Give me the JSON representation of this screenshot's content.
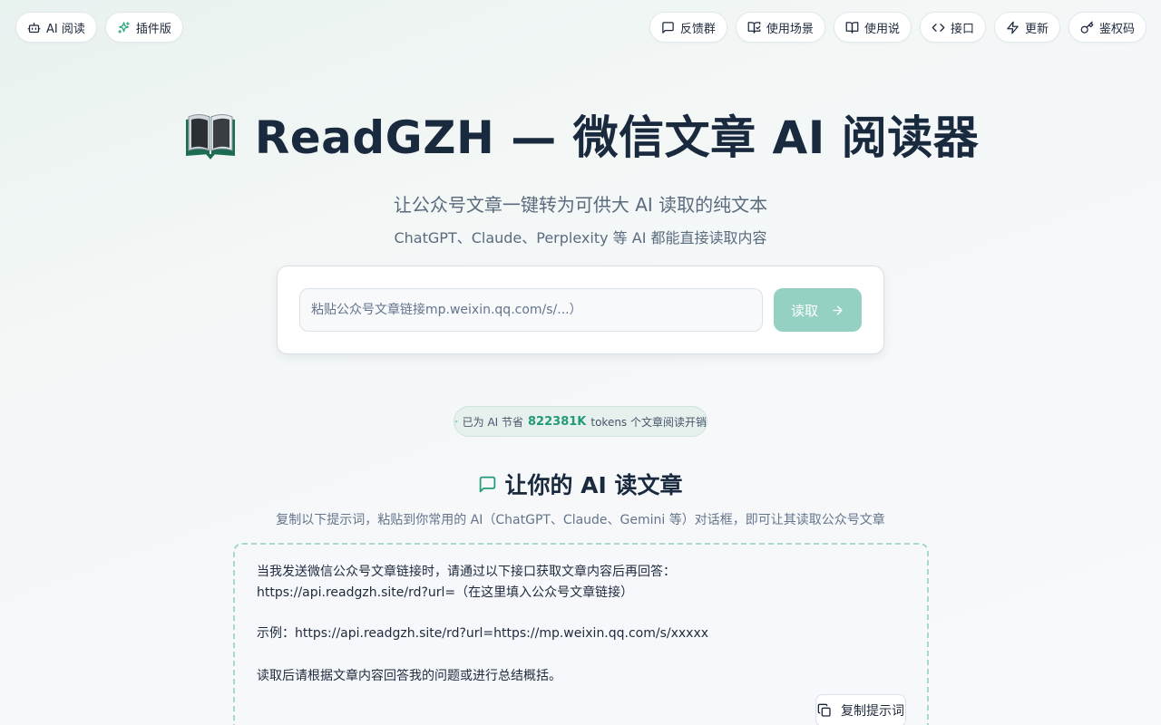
{
  "nav": {
    "left": [
      {
        "label": "AI 阅读",
        "icon": "bot-icon"
      },
      {
        "label": "插件版",
        "icon": "sparkles-icon"
      }
    ],
    "right": [
      {
        "label": "反馈群",
        "icon": "message-icon"
      },
      {
        "label": "使用场景",
        "icon": "book-open-check-icon"
      },
      {
        "label": "使用说",
        "icon": "book-open-icon"
      },
      {
        "label": "接口",
        "icon": "code-icon"
      },
      {
        "label": "更新",
        "icon": "zap-icon"
      },
      {
        "label": "鉴权码",
        "icon": "key-icon"
      }
    ]
  },
  "hero": {
    "emoji": "📖",
    "title": "ReadGZH — 微信文章 AI 阅读器",
    "subtitle": "让公众号文章一键转为可供大 AI 读取的纯文本",
    "description": "ChatGPT、Claude、Perplexity 等 AI 都能直接读取内容"
  },
  "search": {
    "placeholder": "粘贴公众号文章链接mp.weixin.qq.com/s/...）",
    "button_label": "读取"
  },
  "stats": {
    "prefix": "已为 AI 节省",
    "value": "822381K",
    "suffix": "tokens 个文章阅读开销"
  },
  "ai_section": {
    "title": "让你的 AI 读文章",
    "description": "复制以下提示词，粘贴到你常用的 AI（ChatGPT、Claude、Gemini 等）对话框，即可让其读取公众号文章",
    "prompt_lines": [
      "当我发送微信公众号文章链接时，请通过以下接口获取文章内容后再回答：",
      "https://api.readgzh.site/rd?url=（在这里填入公众号文章链接）",
      "",
      "示例：https://api.readgzh.site/rd?url=https://mp.weixin.qq.com/s/xxxxx",
      "",
      "读取后请根据文章内容回答我的问题或进行总结概括。"
    ],
    "copy_label": "复制提示词"
  },
  "colors": {
    "accent": "#239a79",
    "button_disabled": "#95d1c2",
    "dashed_border": "#a8d8c9",
    "title": "#1a2a3e",
    "muted": "#5b6b7e"
  }
}
